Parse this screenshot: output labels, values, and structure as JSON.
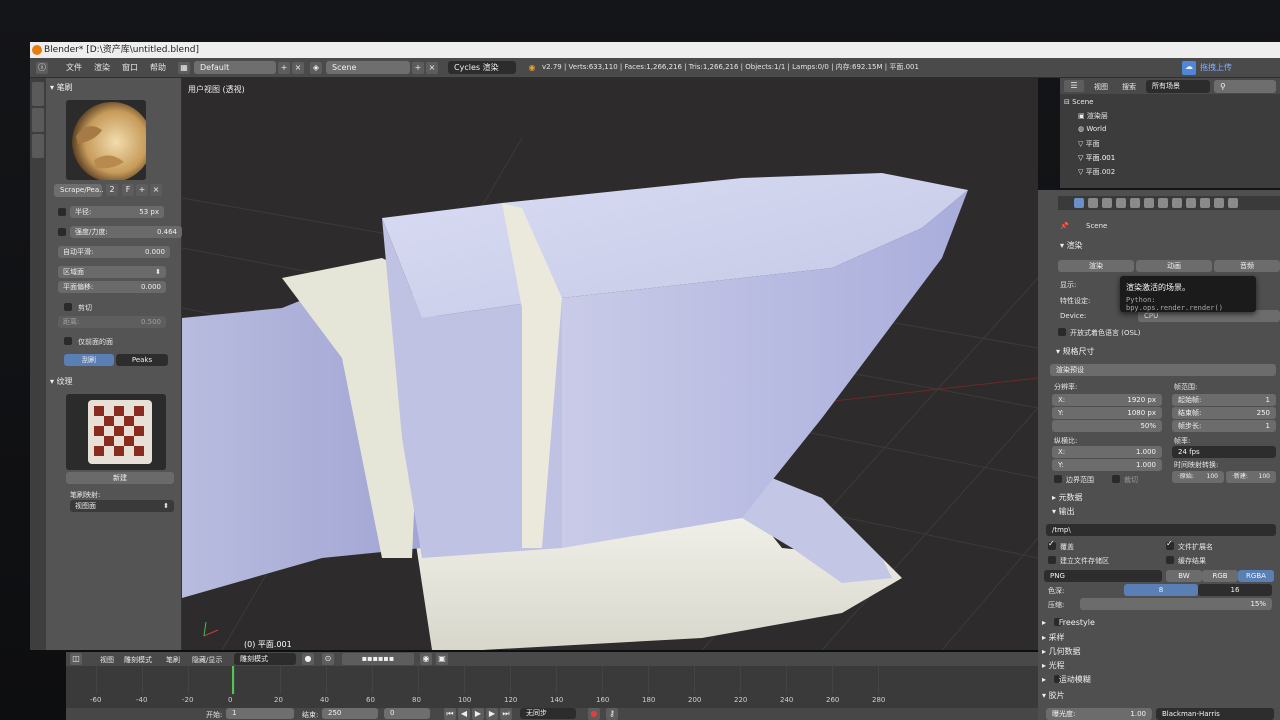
{
  "window": {
    "title": "Blender* [D:\\资产库\\untitled.blend]"
  },
  "topbar": {
    "menus": [
      "文件",
      "渲染",
      "窗口",
      "帮助"
    ],
    "layout": "Default",
    "scene": "Scene",
    "engine": "Cycles 渲染",
    "stats": "v2.79 | Verts:633,110 | Faces:1,266,216 | Tris:1,266,216 | Objects:1/1 | Lamps:0/0 | 内存:692.15M | 平面.001",
    "upload_label": "拖拽上传"
  },
  "left_panel": {
    "brush_header": "笔刷",
    "brush_name": "Scrape/Pea..",
    "brush_users": "2",
    "brush_f": "F",
    "radius_label": "半径:",
    "radius_value": "53 px",
    "strength_label": "强度/力度:",
    "strength_value": "0.464",
    "autosmooth_label": "自动平滑:",
    "autosmooth_value": "0.000",
    "area_plane_label": "区域面",
    "plane_offset_label": "平面偏移:",
    "plane_offset_value": "0.000",
    "trim_label": "剪切",
    "distance_label": "距离:",
    "distance_value": "0.500",
    "front_faces_label": "仅前面的面",
    "mode_options": [
      "刮刷",
      "Peaks"
    ],
    "texture_header": "纹理",
    "new_button": "新建",
    "brush_mapping_label": "笔刷映射:",
    "brush_mapping_value": "视图面"
  },
  "viewport": {
    "title": "用户视图 (透视)",
    "object_label": "(0) 平面.001"
  },
  "outliner": {
    "view_label": "视图",
    "search_label": "搜索",
    "filter_value": "所有场景",
    "items": [
      "Scene",
      "渲染层",
      "World",
      "平面",
      "平面.001",
      "平面.002"
    ]
  },
  "properties": {
    "scene_label": "Scene",
    "render_header": "渲染",
    "render_buttons": [
      "渲染",
      "动画",
      "音频"
    ],
    "display_label": "显示:",
    "feature_set_label": "特性设定:",
    "device_label": "Device:",
    "device_value": "CPU",
    "osl_label": "开放式着色语言 (OSL)",
    "dimensions_header": "规格尺寸",
    "render_preset": "渲染预设",
    "resolution_label": "分辨率:",
    "res_x": "X:",
    "res_x_value": "1920 px",
    "res_y": "Y:",
    "res_y_value": "1080 px",
    "res_percent": "50%",
    "frame_range_label": "帧范围:",
    "start_frame_label": "起始帧:",
    "start_frame_value": "1",
    "end_frame_label": "结束帧:",
    "end_frame_value": "250",
    "frame_step_label": "帧步长:",
    "frame_step_value": "1",
    "aspect_label": "纵横比:",
    "aspect_x": "X:",
    "aspect_x_value": "1.000",
    "aspect_y": "Y:",
    "aspect_y_value": "1.000",
    "frame_rate_label": "帧率:",
    "frame_rate_value": "24 fps",
    "time_remap_label": "时间映射转换:",
    "remap_old_label": "·原始:",
    "remap_old_value": "100",
    "remap_new_label": "·新建:",
    "remap_new_value": "100",
    "border_label": "边界范围",
    "crop_label": "裁切",
    "metadata_header": "元数据",
    "output_header": "输出",
    "output_path": "/tmp\\",
    "overwrite_label": "覆盖",
    "extensions_label": "文件扩展名",
    "placeholders_label": "建立文件存储区",
    "cache_label": "缓存结果",
    "format_value": "PNG",
    "color_modes": [
      "BW",
      "RGB",
      "RGBA"
    ],
    "color_depth_label": "色深:",
    "color_depth_values": [
      "8",
      "16"
    ],
    "compression_label": "压缩:",
    "compression_value": "15%",
    "freestyle_label": "Freestyle",
    "sampling_label": "采样",
    "geometry_label": "几何数据",
    "light_paths_label": "光程",
    "motion_blur_label": "运动模糊",
    "film_label": "胶片",
    "exposure_label": "曝光度:",
    "exposure_value": "1.00",
    "filter_value": "Blackman-Harris"
  },
  "tooltip": {
    "title": "渲染激活的场景。",
    "python": "Python: bpy.ops.render.render()"
  },
  "timeline": {
    "menus": [
      "视图",
      "雕刻模式",
      "笔刷",
      "隐藏/显示"
    ],
    "mode_value": "雕刻模式",
    "ticks": [
      "-60",
      "-40",
      "-20",
      "0",
      "20",
      "40",
      "60",
      "80",
      "100",
      "120",
      "140",
      "160",
      "180",
      "200",
      "220",
      "240",
      "260",
      "280"
    ],
    "start_label": "开始:",
    "start_value": "1",
    "end_label": "结束:",
    "end_value": "250",
    "current_frame": "0",
    "sync_value": "无同步"
  },
  "colors": {
    "ui_bg": "#545454",
    "viewport_bg": "#2d2b2b",
    "accent_blue": "#5a7fb4",
    "blender_orange": "#e87d0d",
    "mesh_color": "#b8bde0"
  }
}
